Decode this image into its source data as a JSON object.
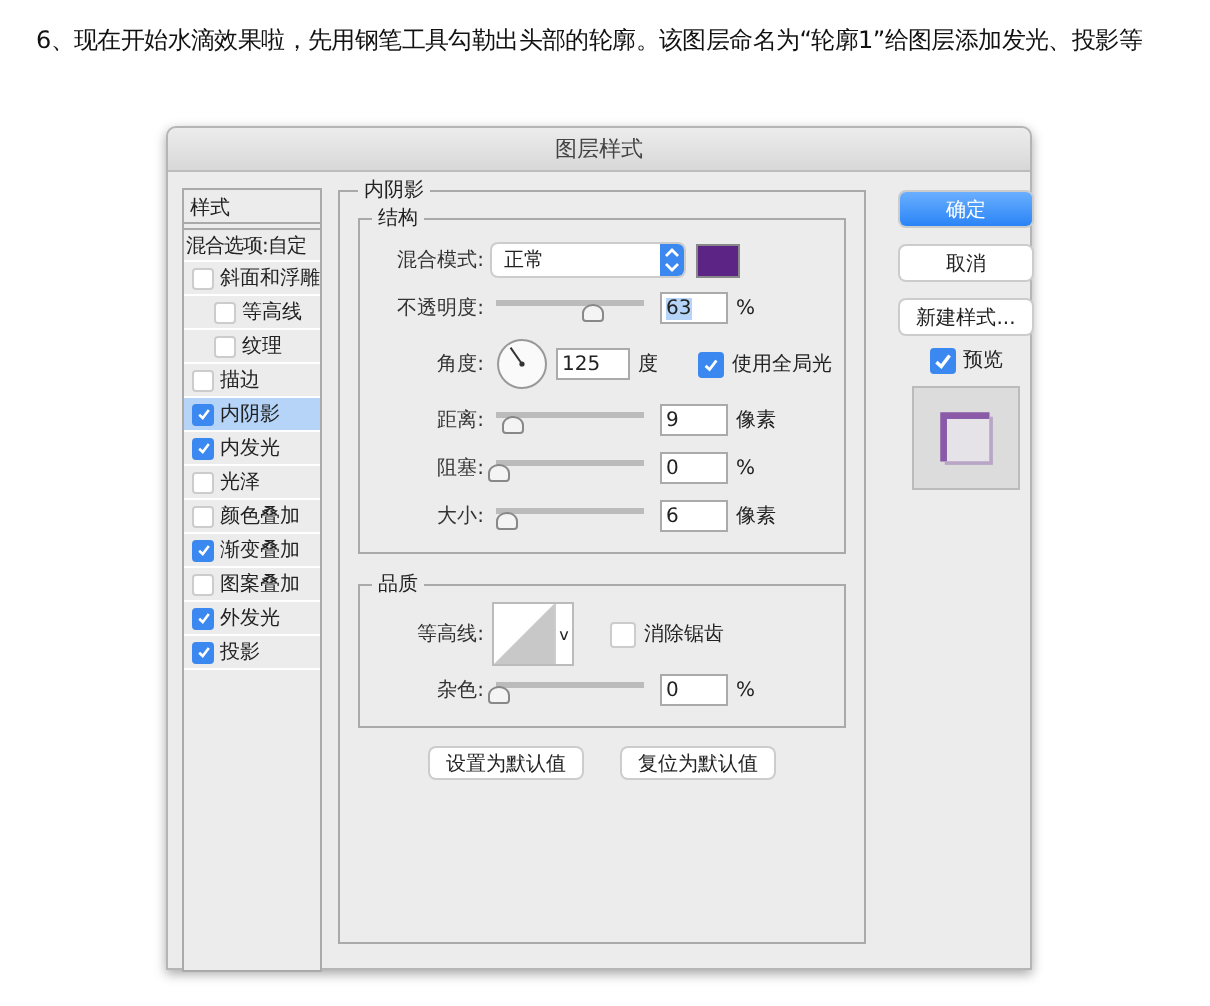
{
  "intro": "6、现在开始水滴效果啦，先用钢笔工具勾勒出头部的轮廓。该图层命名为“轮廓1”给图层添加发光、投影等",
  "dialog": {
    "title": "图层样式",
    "sidebar": {
      "header": "样式",
      "blend_options": "混合选项:自定",
      "items": [
        {
          "label": "斜面和浮雕",
          "checked": false,
          "selected": false,
          "children": [
            {
              "label": "等高线",
              "checked": false,
              "selected": false
            },
            {
              "label": "纹理",
              "checked": false,
              "selected": false
            }
          ]
        },
        {
          "label": "描边",
          "checked": false,
          "selected": false
        },
        {
          "label": "内阴影",
          "checked": true,
          "selected": true
        },
        {
          "label": "内发光",
          "checked": true,
          "selected": false
        },
        {
          "label": "光泽",
          "checked": false,
          "selected": false
        },
        {
          "label": "颜色叠加",
          "checked": false,
          "selected": false
        },
        {
          "label": "渐变叠加",
          "checked": true,
          "selected": false
        },
        {
          "label": "图案叠加",
          "checked": false,
          "selected": false
        },
        {
          "label": "外发光",
          "checked": true,
          "selected": false
        },
        {
          "label": "投影",
          "checked": true,
          "selected": false
        }
      ]
    },
    "panel": {
      "legend": "内阴影",
      "structure": {
        "legend": "结构",
        "blend_label": "混合模式:",
        "blend_value": "正常",
        "rows": [
          {
            "kind": "slider",
            "label": "不透明度:",
            "level": 0.63,
            "value": "63",
            "unit": "%",
            "highlighted": true
          },
          {
            "kind": "angle",
            "label": "角度:",
            "value": "125",
            "unit": "度",
            "global_light": {
              "label": "使用全局光",
              "checked": true
            }
          },
          {
            "kind": "slider",
            "label": "距离:",
            "level": 0.09,
            "value": "9",
            "unit": "像素",
            "highlighted": false
          },
          {
            "kind": "slider",
            "label": "阻塞:",
            "level": 0,
            "value": "0",
            "unit": "%",
            "highlighted": false
          },
          {
            "kind": "slider",
            "label": "大小:",
            "level": 0.06,
            "value": "6",
            "unit": "像素",
            "highlighted": false
          }
        ]
      },
      "quality": {
        "legend": "品质",
        "contour_label": "等高线:",
        "contour_caret": "v",
        "anti_alias": {
          "label": "消除锯齿",
          "checked": false
        },
        "noise": {
          "label": "杂色:",
          "level": 0,
          "value": "0",
          "unit": "%"
        }
      },
      "buttons": [
        "设置为默认值",
        "复位为默认值"
      ]
    },
    "ok": "确定",
    "cancel": "取消",
    "new_style": "新建样式...",
    "preview": {
      "label": "预览",
      "checked": true
    }
  }
}
